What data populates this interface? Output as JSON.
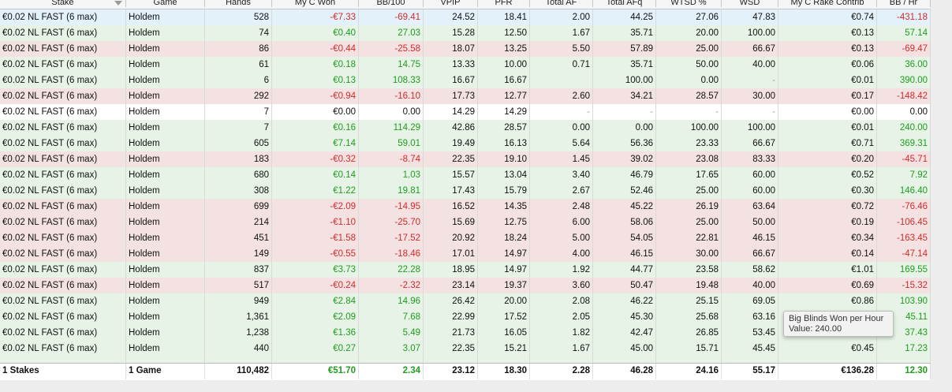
{
  "columns": [
    {
      "key": "stake",
      "label": "Stake",
      "width": 160,
      "align": "l",
      "sort": true
    },
    {
      "key": "game",
      "label": "Game",
      "width": 100,
      "align": "l"
    },
    {
      "key": "hands",
      "label": "Hands",
      "width": 85,
      "align": "r"
    },
    {
      "key": "won",
      "label": "My C Won",
      "width": 110,
      "align": "r"
    },
    {
      "key": "bb100",
      "label": "BB/100",
      "width": 82,
      "align": "r"
    },
    {
      "key": "vpip",
      "label": "VPIP",
      "width": 69,
      "align": "r"
    },
    {
      "key": "pfr",
      "label": "PFR",
      "width": 66,
      "align": "r"
    },
    {
      "key": "af",
      "label": "Total AF",
      "width": 80,
      "align": "r"
    },
    {
      "key": "afq",
      "label": "Total AFq",
      "width": 80,
      "align": "r"
    },
    {
      "key": "wtsd",
      "label": "WTSD %",
      "width": 83,
      "align": "r"
    },
    {
      "key": "wsd",
      "label": "WSD",
      "width": 72,
      "align": "r"
    },
    {
      "key": "rake",
      "label": "My C Rake Contrib",
      "width": 125,
      "align": "r"
    },
    {
      "key": "bbhr",
      "label": "BB / Hr",
      "width": 68,
      "align": "r"
    }
  ],
  "rows": [
    {
      "tone": "sel",
      "stake": "€0.02 NL FAST (6 max)",
      "game": "Holdem",
      "hands": "528",
      "won": "-€7.33",
      "bb100": "-69.41",
      "vpip": "24.52",
      "pfr": "18.41",
      "af": "2.00",
      "afq": "44.25",
      "wtsd": "27.06",
      "wsd": "47.83",
      "rake": "€0.74",
      "bbhr": "-431.18"
    },
    {
      "tone": "pos",
      "stake": "€0.02 NL FAST (6 max)",
      "game": "Holdem",
      "hands": "74",
      "won": "€0.40",
      "bb100": "27.03",
      "vpip": "15.28",
      "pfr": "12.50",
      "af": "1.67",
      "afq": "35.71",
      "wtsd": "20.00",
      "wsd": "100.00",
      "rake": "€0.13",
      "bbhr": "57.14"
    },
    {
      "tone": "neg",
      "stake": "€0.02 NL FAST (6 max)",
      "game": "Holdem",
      "hands": "86",
      "won": "-€0.44",
      "bb100": "-25.58",
      "vpip": "18.07",
      "pfr": "13.25",
      "af": "5.50",
      "afq": "57.89",
      "wtsd": "25.00",
      "wsd": "66.67",
      "rake": "€0.13",
      "bbhr": "-69.47"
    },
    {
      "tone": "pos",
      "stake": "€0.02 NL FAST (6 max)",
      "game": "Holdem",
      "hands": "61",
      "won": "€0.18",
      "bb100": "14.75",
      "vpip": "13.33",
      "pfr": "10.00",
      "af": "0.71",
      "afq": "35.71",
      "wtsd": "50.00",
      "wsd": "40.00",
      "rake": "€0.06",
      "bbhr": "36.00"
    },
    {
      "tone": "pos",
      "stake": "€0.02 NL FAST (6 max)",
      "game": "Holdem",
      "hands": "6",
      "won": "€0.13",
      "bb100": "108.33",
      "vpip": "16.67",
      "pfr": "16.67",
      "af": "",
      "afq": "100.00",
      "wtsd": "0.00",
      "wsd": "-",
      "rake": "€0.01",
      "bbhr": "390.00"
    },
    {
      "tone": "neg",
      "stake": "€0.02 NL FAST (6 max)",
      "game": "Holdem",
      "hands": "292",
      "won": "-€0.94",
      "bb100": "-16.10",
      "vpip": "17.73",
      "pfr": "12.77",
      "af": "2.60",
      "afq": "34.21",
      "wtsd": "28.57",
      "wsd": "30.00",
      "rake": "€0.17",
      "bbhr": "-148.42"
    },
    {
      "tone": "neu",
      "stake": "€0.02 NL FAST (6 max)",
      "game": "Holdem",
      "hands": "7",
      "won": "€0.00",
      "bb100": "0.00",
      "vpip": "14.29",
      "pfr": "14.29",
      "af": "-",
      "afq": "-",
      "wtsd": "-",
      "wsd": "-",
      "rake": "€0.00",
      "bbhr": "0.00"
    },
    {
      "tone": "pos",
      "stake": "€0.02 NL FAST (6 max)",
      "game": "Holdem",
      "hands": "7",
      "won": "€0.16",
      "bb100": "114.29",
      "vpip": "42.86",
      "pfr": "28.57",
      "af": "0.00",
      "afq": "0.00",
      "wtsd": "100.00",
      "wsd": "100.00",
      "rake": "€0.01",
      "bbhr": "240.00"
    },
    {
      "tone": "pos",
      "stake": "€0.02 NL FAST (6 max)",
      "game": "Holdem",
      "hands": "605",
      "won": "€7.14",
      "bb100": "59.01",
      "vpip": "19.49",
      "pfr": "16.13",
      "af": "5.64",
      "afq": "56.36",
      "wtsd": "23.33",
      "wsd": "66.67",
      "rake": "€0.71",
      "bbhr": "369.31"
    },
    {
      "tone": "neg",
      "stake": "€0.02 NL FAST (6 max)",
      "game": "Holdem",
      "hands": "183",
      "won": "-€0.32",
      "bb100": "-8.74",
      "vpip": "22.35",
      "pfr": "19.10",
      "af": "1.45",
      "afq": "39.02",
      "wtsd": "23.08",
      "wsd": "83.33",
      "rake": "€0.20",
      "bbhr": "-45.71"
    },
    {
      "tone": "pos",
      "stake": "€0.02 NL FAST (6 max)",
      "game": "Holdem",
      "hands": "680",
      "won": "€0.14",
      "bb100": "1.03",
      "vpip": "15.57",
      "pfr": "13.04",
      "af": "3.40",
      "afq": "46.79",
      "wtsd": "17.65",
      "wsd": "60.00",
      "rake": "€0.52",
      "bbhr": "7.92"
    },
    {
      "tone": "pos",
      "stake": "€0.02 NL FAST (6 max)",
      "game": "Holdem",
      "hands": "308",
      "won": "€1.22",
      "bb100": "19.81",
      "vpip": "17.43",
      "pfr": "15.79",
      "af": "2.67",
      "afq": "52.46",
      "wtsd": "25.00",
      "wsd": "60.00",
      "rake": "€0.30",
      "bbhr": "146.40"
    },
    {
      "tone": "neg",
      "stake": "€0.02 NL FAST (6 max)",
      "game": "Holdem",
      "hands": "699",
      "won": "-€2.09",
      "bb100": "-14.95",
      "vpip": "16.52",
      "pfr": "14.35",
      "af": "2.48",
      "afq": "45.22",
      "wtsd": "26.19",
      "wsd": "63.64",
      "rake": "€0.72",
      "bbhr": "-76.46"
    },
    {
      "tone": "neg",
      "stake": "€0.02 NL FAST (6 max)",
      "game": "Holdem",
      "hands": "214",
      "won": "-€1.10",
      "bb100": "-25.70",
      "vpip": "15.69",
      "pfr": "12.75",
      "af": "6.00",
      "afq": "58.06",
      "wtsd": "25.00",
      "wsd": "50.00",
      "rake": "€0.19",
      "bbhr": "-106.45"
    },
    {
      "tone": "neg",
      "stake": "€0.02 NL FAST (6 max)",
      "game": "Holdem",
      "hands": "451",
      "won": "-€1.58",
      "bb100": "-17.52",
      "vpip": "20.92",
      "pfr": "18.24",
      "af": "5.00",
      "afq": "54.05",
      "wtsd": "22.81",
      "wsd": "46.15",
      "rake": "€0.34",
      "bbhr": "-163.45"
    },
    {
      "tone": "neg",
      "stake": "€0.02 NL FAST (6 max)",
      "game": "Holdem",
      "hands": "149",
      "won": "-€0.55",
      "bb100": "-18.46",
      "vpip": "17.01",
      "pfr": "14.97",
      "af": "4.00",
      "afq": "46.15",
      "wtsd": "30.00",
      "wsd": "66.67",
      "rake": "€0.14",
      "bbhr": "-47.14"
    },
    {
      "tone": "pos",
      "stake": "€0.02 NL FAST (6 max)",
      "game": "Holdem",
      "hands": "837",
      "won": "€3.73",
      "bb100": "22.28",
      "vpip": "18.95",
      "pfr": "14.97",
      "af": "1.92",
      "afq": "44.77",
      "wtsd": "23.58",
      "wsd": "58.62",
      "rake": "€1.01",
      "bbhr": "169.55"
    },
    {
      "tone": "neg",
      "stake": "€0.02 NL FAST (6 max)",
      "game": "Holdem",
      "hands": "517",
      "won": "-€0.24",
      "bb100": "-2.32",
      "vpip": "23.14",
      "pfr": "19.37",
      "af": "3.60",
      "afq": "50.47",
      "wtsd": "19.48",
      "wsd": "40.00",
      "rake": "€0.69",
      "bbhr": "-15.32"
    },
    {
      "tone": "pos",
      "stake": "€0.02 NL FAST (6 max)",
      "game": "Holdem",
      "hands": "949",
      "won": "€2.84",
      "bb100": "14.96",
      "vpip": "26.42",
      "pfr": "20.00",
      "af": "2.08",
      "afq": "46.22",
      "wtsd": "25.15",
      "wsd": "69.05",
      "rake": "€0.86",
      "bbhr": "103.90"
    },
    {
      "tone": "pos",
      "stake": "€0.02 NL FAST (6 max)",
      "game": "Holdem",
      "hands": "1,361",
      "won": "€2.09",
      "bb100": "7.68",
      "vpip": "22.99",
      "pfr": "17.52",
      "af": "2.05",
      "afq": "45.30",
      "wtsd": "25.68",
      "wsd": "63.16",
      "rake": "",
      "bbhr": "45.11"
    },
    {
      "tone": "pos",
      "stake": "€0.02 NL FAST (6 max)",
      "game": "Holdem",
      "hands": "1,238",
      "won": "€1.36",
      "bb100": "5.49",
      "vpip": "21.73",
      "pfr": "16.05",
      "af": "1.82",
      "afq": "42.47",
      "wtsd": "26.85",
      "wsd": "53.45",
      "rake": "",
      "bbhr": "37.43"
    },
    {
      "tone": "pos",
      "stake": "€0.02 NL FAST (6 max)",
      "game": "Holdem",
      "hands": "440",
      "won": "€0.27",
      "bb100": "3.07",
      "vpip": "22.35",
      "pfr": "15.21",
      "af": "1.67",
      "afq": "45.00",
      "wtsd": "15.71",
      "wsd": "45.45",
      "rake": "€0.45",
      "bbhr": "17.23"
    }
  ],
  "totals": {
    "stake": "1 Stakes",
    "game": "1 Game",
    "hands": "110,482",
    "won": "€51.70",
    "bb100": "2.34",
    "vpip": "23.12",
    "pfr": "18.30",
    "af": "2.28",
    "afq": "46.28",
    "wtsd": "24.16",
    "wsd": "55.17",
    "rake": "€136.28",
    "bbhr": "12.30"
  },
  "tooltip": {
    "line1": "Big Blinds Won per Hour",
    "line2": "Value: 240.00"
  },
  "colors": {
    "positive": "#1f9d1f",
    "negative": "#d42a2a",
    "row_pos": "#e6f3e6",
    "row_neg": "#f4e1e1",
    "row_selected": "#e3f1fb"
  },
  "icons": {
    "sort": "sort-down-triangle-icon"
  }
}
